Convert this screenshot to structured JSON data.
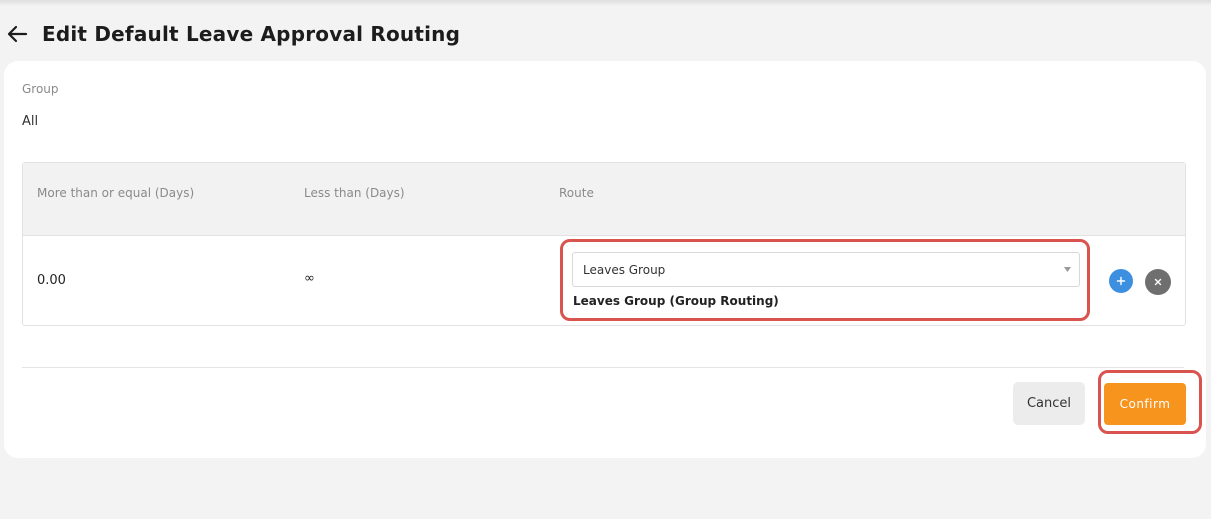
{
  "header": {
    "title": "Edit Default Leave Approval Routing",
    "back_icon": "arrow-left-icon"
  },
  "group": {
    "label": "Group",
    "value": "All"
  },
  "table": {
    "columns": [
      "More than or equal (Days)",
      "Less than (Days)",
      "Route"
    ],
    "rows": [
      {
        "more_than_or_equal": "0.00",
        "less_than": "∞",
        "route_selected": "Leaves Group",
        "route_detail": "Leaves Group (Group Routing)"
      }
    ],
    "add_icon": "plus-icon",
    "remove_icon": "close-icon"
  },
  "actions": {
    "cancel_label": "Cancel",
    "confirm_label": "Confirm"
  },
  "colors": {
    "accent": "#f7941d",
    "highlight": "#d9534f",
    "add_button": "#3d8fe0",
    "remove_button": "#6f6f6f"
  }
}
